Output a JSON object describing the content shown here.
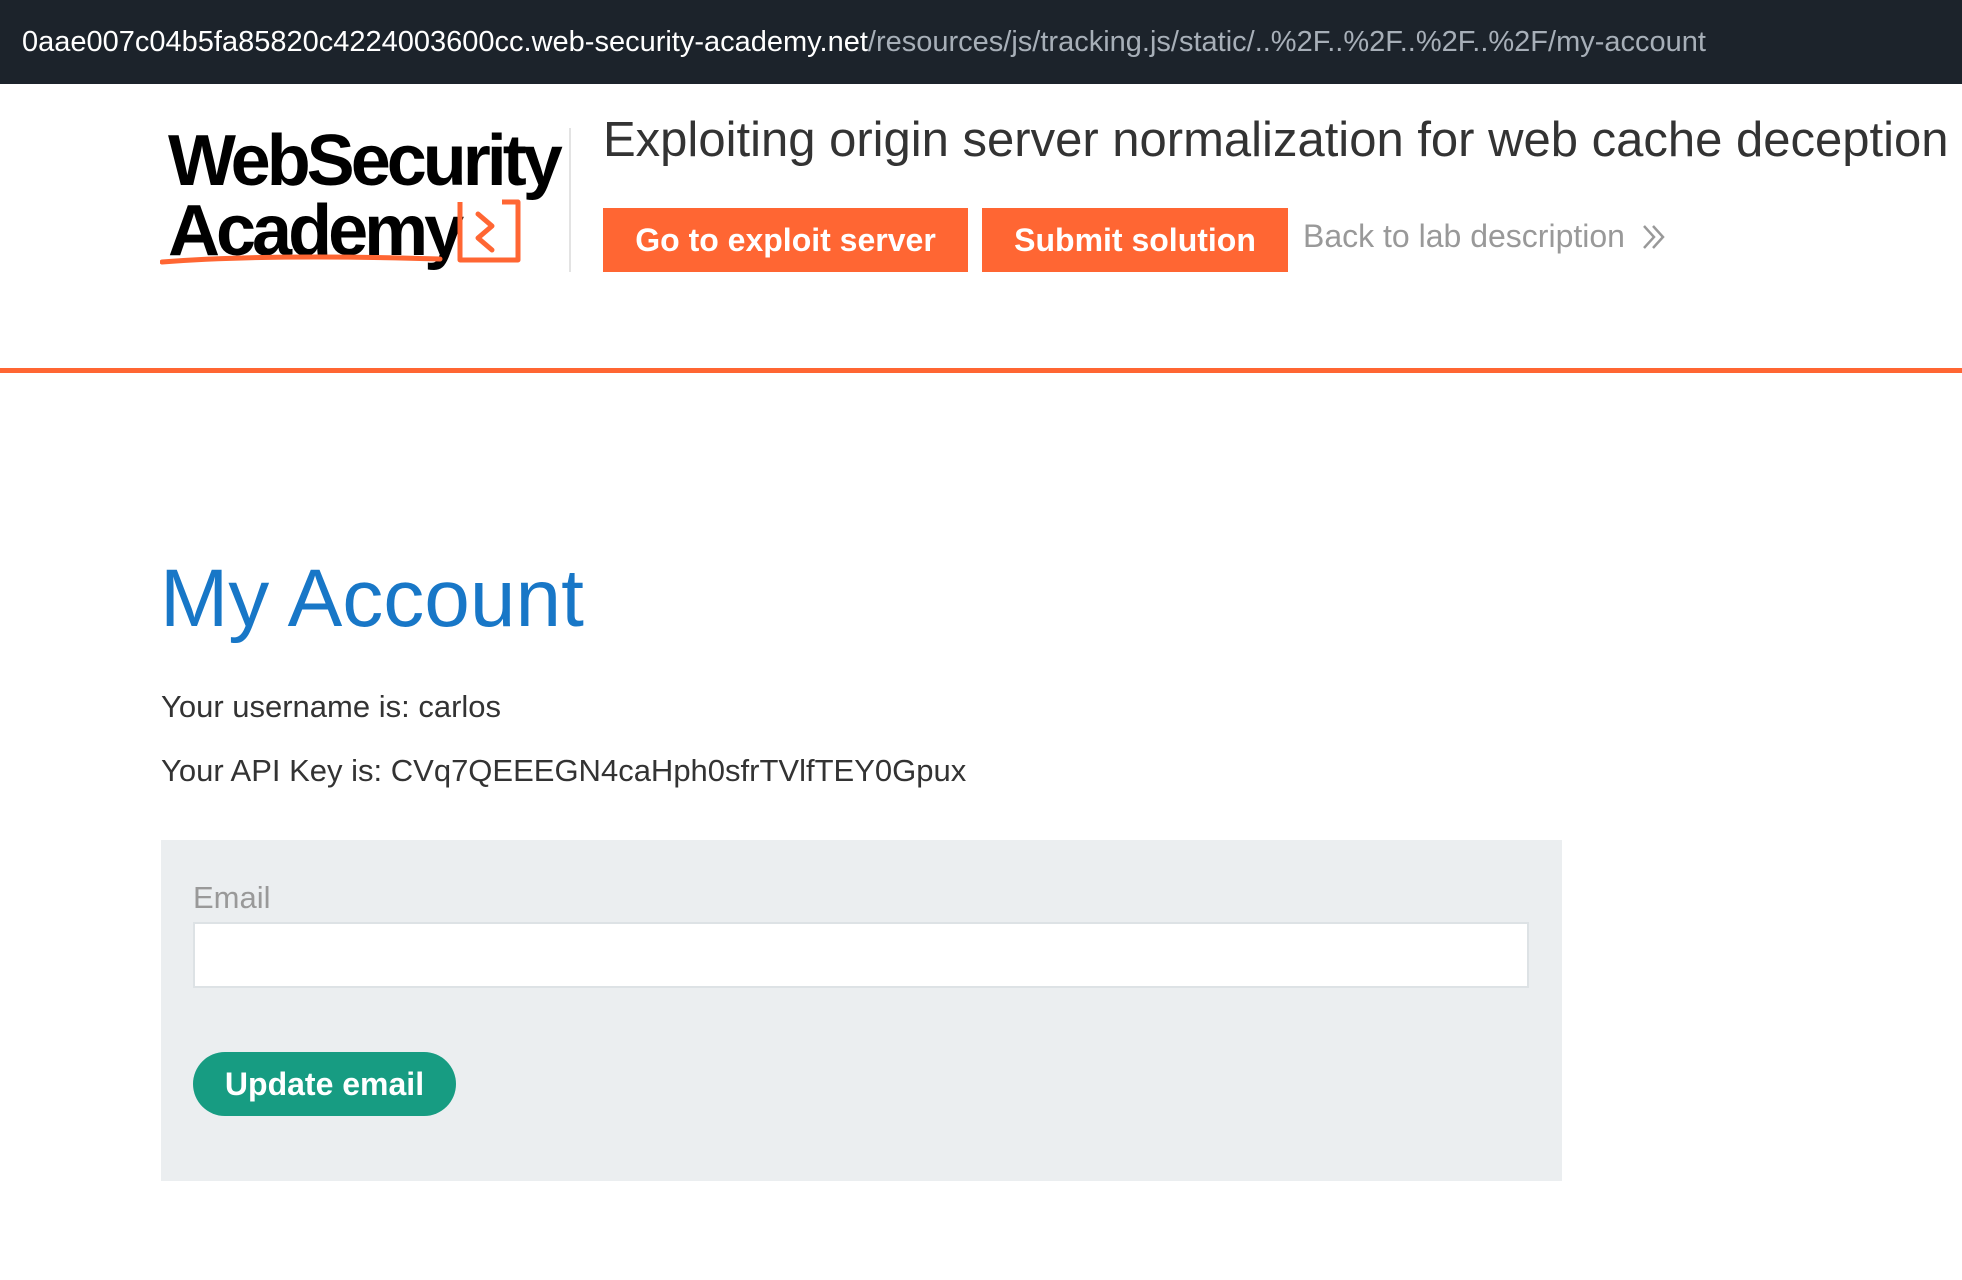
{
  "browser": {
    "url_host": "0aae007c04b5fa85820c4224003600cc.web-security-academy.net",
    "url_path": "/resources/js/tracking.js/static/..%2F..%2F..%2F..%2F/my-account"
  },
  "header": {
    "logo_line1": "WebSecurity",
    "logo_line2": "Academy",
    "lab_title": "Exploiting origin server normalization for web cache deception",
    "exploit_button": "Go to exploit server",
    "submit_button": "Submit solution",
    "back_link": "Back to lab description",
    "accent_color": "#ff6633"
  },
  "main": {
    "title": "My Account",
    "username_line": "Your username is: carlos",
    "api_key_line": "Your API Key is: CVq7QEEEGN4caHph0sfrTVlfTEY0Gpux",
    "form": {
      "email_label": "Email",
      "email_value": "",
      "update_button": "Update email",
      "button_color": "#179c82"
    }
  }
}
